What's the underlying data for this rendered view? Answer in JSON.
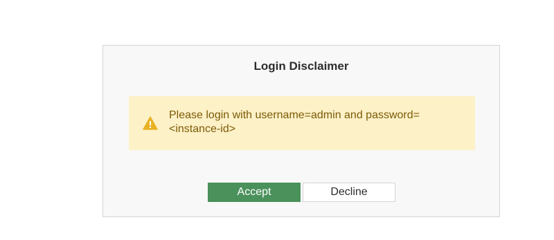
{
  "dialog": {
    "title": "Login Disclaimer",
    "message": "Please login with username=admin and password=<instance-id>",
    "accept_label": "Accept",
    "decline_label": "Decline"
  },
  "icons": {
    "warning": "warning-icon"
  },
  "colors": {
    "accent": "#4a915b",
    "warning_bg": "#fdf1c8",
    "warning_text": "#7c5a05",
    "warning_icon": "#e8b225"
  }
}
